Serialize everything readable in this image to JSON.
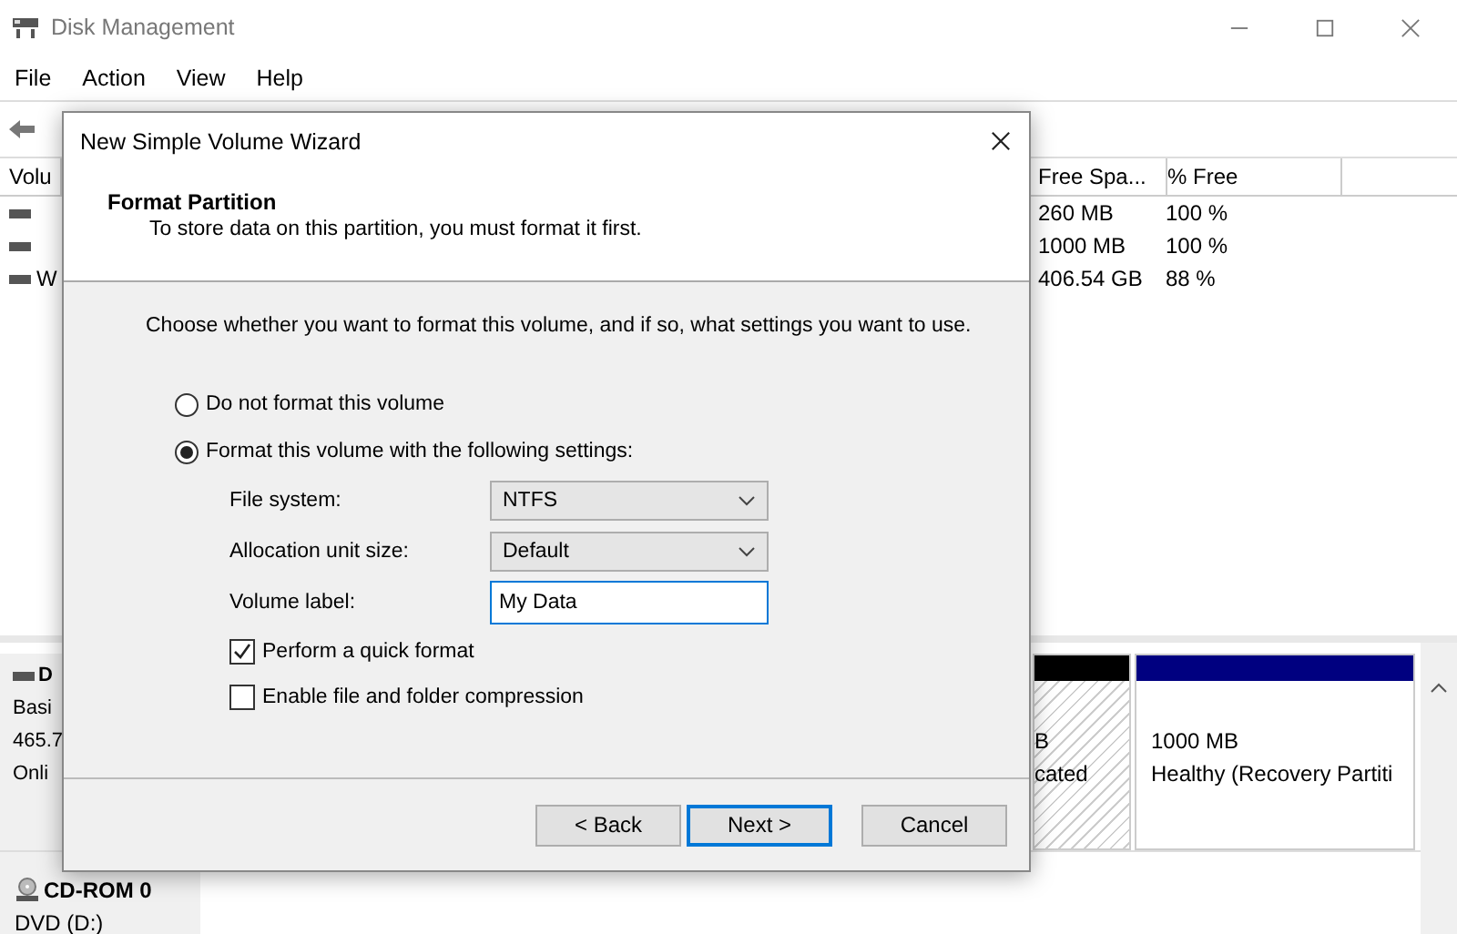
{
  "window": {
    "title": "Disk Management"
  },
  "menu": [
    "File",
    "Action",
    "View",
    "Help"
  ],
  "volume_table": {
    "columns": [
      "Volu",
      "Free Spa...",
      "% Free"
    ],
    "rows": [
      {
        "free_space": "260 MB",
        "percent_free": "100 %"
      },
      {
        "free_space": "1000 MB",
        "percent_free": "100 %"
      },
      {
        "column_1": "W",
        "free_space": "406.54 GB",
        "percent_free": "88 %"
      }
    ]
  },
  "disks": [
    {
      "kind": "disk",
      "name": "D",
      "lines": [
        "Basi",
        "465.7",
        "Onli"
      ],
      "partitions": [
        {
          "kind": "unallocated",
          "lines": [
            "B",
            "cated"
          ]
        },
        {
          "kind": "primary",
          "lines": [
            "1000 MB",
            "Healthy (Recovery Partiti"
          ]
        }
      ]
    },
    {
      "kind": "cdrom",
      "name": "CD-ROM 0",
      "lines": [
        "DVD (D:)"
      ]
    }
  ],
  "dialog": {
    "title": "New Simple Volume Wizard",
    "heading": "Format Partition",
    "subtitle": "To store data on this partition, you must format it first.",
    "instruction": "Choose whether you want to format this volume, and if so, what settings you want to use.",
    "options": [
      {
        "label": "Do not format this volume",
        "selected": false
      },
      {
        "label": "Format this volume with the following settings:",
        "selected": true
      }
    ],
    "fields": [
      {
        "kind": "select",
        "label": "File system:",
        "value": "NTFS"
      },
      {
        "kind": "select",
        "label": "Allocation unit size:",
        "value": "Default"
      },
      {
        "kind": "text",
        "label": "Volume label:",
        "value": "My Data"
      }
    ],
    "checkboxes": [
      {
        "label": "Perform a quick format",
        "checked": true
      },
      {
        "label": "Enable file and folder compression",
        "checked": false
      }
    ],
    "buttons": [
      {
        "label": "< Back",
        "focused": false
      },
      {
        "label": "Next >",
        "focused": true
      },
      {
        "label": "Cancel",
        "focused": false
      }
    ]
  }
}
